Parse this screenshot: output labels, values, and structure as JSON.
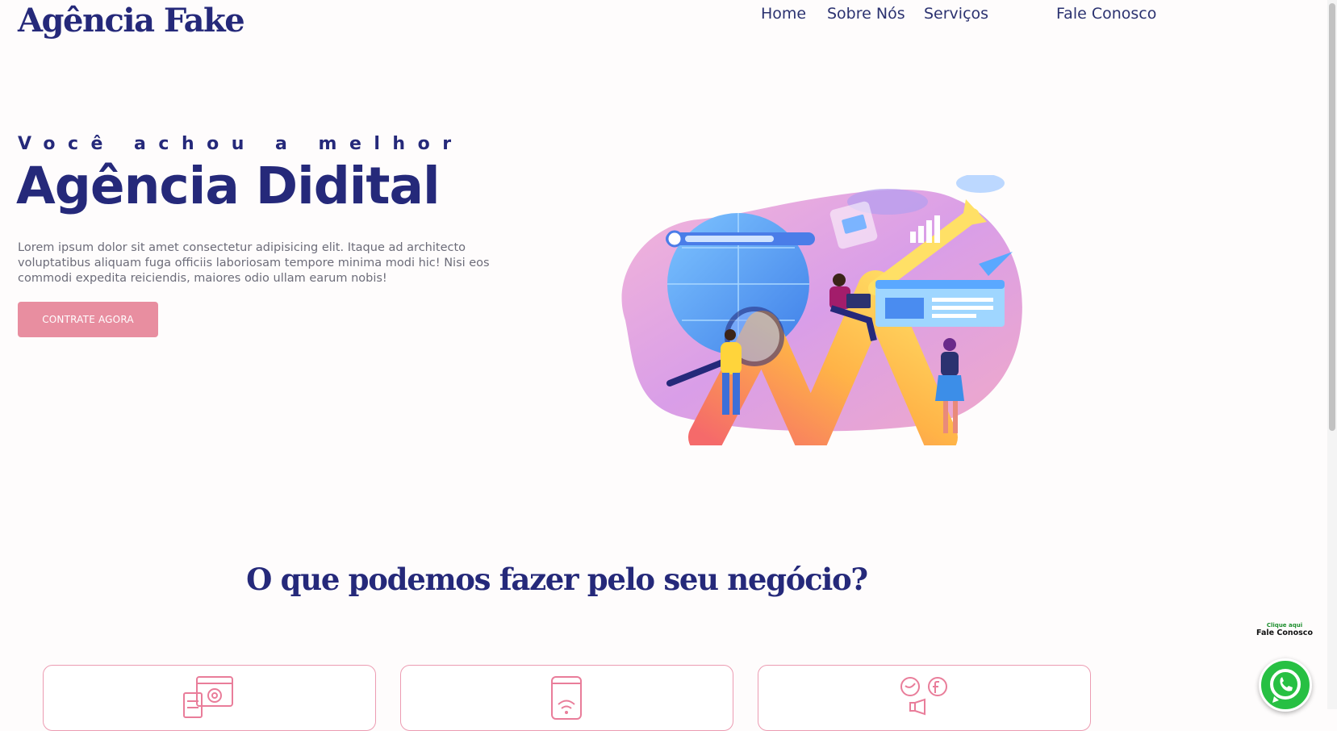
{
  "brand": {
    "logo_text": "Agência Fake",
    "primary_color": "#25297a",
    "accent_color": "#e88ea0"
  },
  "nav": {
    "items": [
      "Home",
      "Sobre Nós",
      "Serviços",
      "Fale Conosco"
    ]
  },
  "hero": {
    "eyebrow": "Você achou a melhor",
    "title": "Agência Didital",
    "text": "Lorem ipsum dolor sit amet consectetur adipisicing elit. Itaque ad architecto voluptatibus aliquam fuga officiis laboriosam tempore minima modi hic! Nisi eos commodi expedita reiciendis, maiores odio ullam earum nobis!",
    "cta_label": "CONTRATE AGORA",
    "illustration": "digital-marketing-illustration"
  },
  "services": {
    "title": "O que podemos fazer pelo seu negócio?",
    "cards": [
      {
        "icon": "web-settings-icon"
      },
      {
        "icon": "mobile-wifi-icon"
      },
      {
        "icon": "social-media-icon"
      }
    ]
  },
  "whatsapp": {
    "small_label": "Clique aqui",
    "big_label": "Fale Conosco",
    "icon": "whatsapp-icon",
    "color": "#27c043"
  }
}
